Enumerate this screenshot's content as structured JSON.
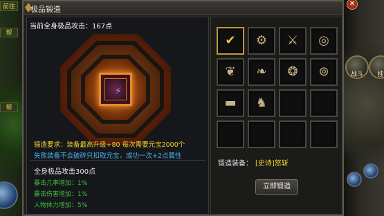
{
  "window": {
    "title": "极品锻造"
  },
  "left": {
    "attack_header": "当前全身极品攻击：167点",
    "requirement": "锻造要求：装备最高升级+80 每次需要元宝2000个",
    "failure_note": "失败装备不会破碎只扣取元宝，成功一次+2点属性",
    "attr_header": "全身极品攻击300点",
    "attributes": [
      "暴击几率增加：1%",
      "暴击伤害增加：1%",
      "人物体力增加：5%"
    ]
  },
  "right": {
    "slots": [
      {
        "icon": "check-icon",
        "glyph": "✔",
        "active": true
      },
      {
        "icon": "ring-icon",
        "glyph": "⚙"
      },
      {
        "icon": "sword-icon",
        "glyph": "⚔"
      },
      {
        "icon": "ring-icon",
        "glyph": "◎"
      },
      {
        "icon": "necklace-icon",
        "glyph": "❦"
      },
      {
        "icon": "bracelet-icon",
        "glyph": "❧"
      },
      {
        "icon": "ring-icon",
        "glyph": "❂"
      },
      {
        "icon": "ring-icon",
        "glyph": "⊚"
      },
      {
        "icon": "belt-icon",
        "glyph": "▬"
      },
      {
        "icon": "boots-icon",
        "glyph": "♞"
      },
      {
        "icon": "empty-slot",
        "glyph": ""
      },
      {
        "icon": "empty-slot",
        "glyph": ""
      },
      {
        "icon": "empty-slot",
        "glyph": ""
      },
      {
        "icon": "empty-slot",
        "glyph": ""
      },
      {
        "icon": "empty-slot",
        "glyph": ""
      },
      {
        "icon": "empty-slot",
        "glyph": ""
      }
    ],
    "forge_label": "锻造装备：",
    "forge_item": "[史诗]怒斩",
    "forge_button": "立即锻造"
  },
  "side": {
    "left_tags": [
      "前往",
      "帮",
      "帮"
    ],
    "right_buttons": [
      "战斗",
      "挂"
    ]
  },
  "colors": {
    "gold": "#f0d030",
    "blue": "#40b0f0",
    "green": "#3ec03e",
    "accent": "#c09a3a"
  }
}
